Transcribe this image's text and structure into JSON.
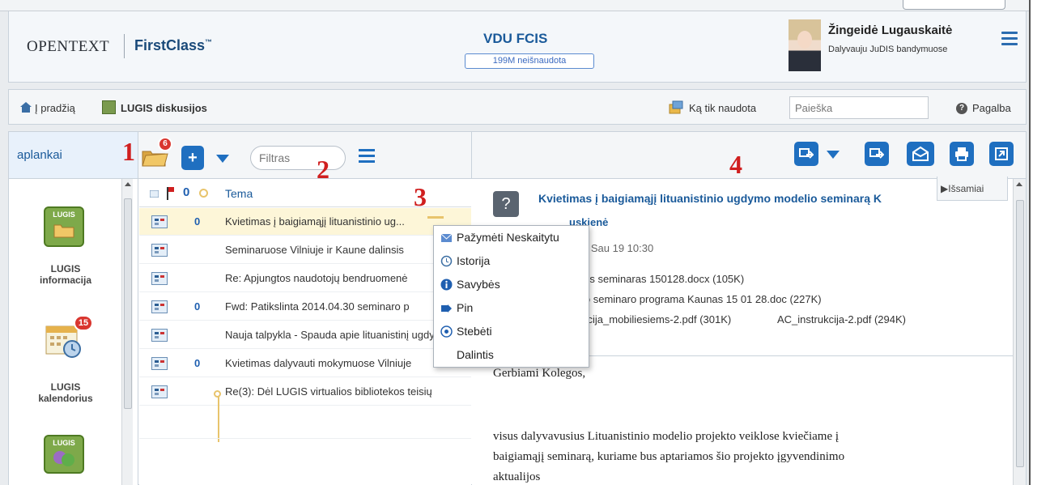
{
  "header": {
    "logo_brand": "OPENTEXT",
    "logo_product": "FirstClass",
    "logo_tm": "™",
    "server_name": "VDU FCIS",
    "server_usage": "199M neišnaudota",
    "user_name": "Žingeidė Lugauskaitė",
    "user_status": "Dalyvauju JuDIS bandymuose"
  },
  "navbar": {
    "home_label": "Į pradžią",
    "folder_label": "LUGIS diskusijos",
    "recent_label": "Ką tik naudota",
    "search_placeholder": "Paieška",
    "help_label": "Pagalba"
  },
  "toolbar": {
    "tab_label": "aplankai",
    "folder_badge": "6",
    "add_label": "+",
    "filter_placeholder": "Filtras"
  },
  "annotations": [
    "1",
    "2",
    "3",
    "4"
  ],
  "folders": [
    {
      "label_line1": "LUGIS",
      "label_line2": "informacija",
      "icon_text": "LUGIS"
    },
    {
      "label_line1": "LUGIS",
      "label_line2": "kalendorius",
      "badge": "15"
    },
    {
      "label_line1": "",
      "label_line2": "",
      "icon_text": "LUGIS"
    }
  ],
  "list": {
    "column_tema": "Tema",
    "rows": [
      {
        "subject": "Kvietimas į baigiamąjį lituanistinio ug...",
        "attachment": true,
        "selected": true
      },
      {
        "subject": "Seminaruose Vilniuje ir Kaune dalinsis",
        "attachment": false
      },
      {
        "subject": "Re: Apjungtos naudotojų bendruomenė",
        "attachment": false
      },
      {
        "subject": "Fwd: Patikslinta 2014.04.30 seminaro p",
        "attachment": true
      },
      {
        "subject": "Nauja talpykla - Spauda apie lituanistinį ugdym",
        "attachment": false
      },
      {
        "subject": "Kvietimas dalyvauti mokymuose Vilniuje",
        "attachment": true
      },
      {
        "subject": "Re(3): Dėl LUGIS virtualios bibliotekos teisių",
        "attachment": false
      }
    ]
  },
  "context_menu": {
    "items": [
      "Pažymėti Neskaitytu",
      "Istorija",
      "Savybės",
      "Pin",
      "Stebėti",
      "Dalintis"
    ]
  },
  "reader": {
    "title": "Kvietimas į baigiamąjį lituanistinio ugdymo modelio seminarą K",
    "expand_label": "▶Išsamiai",
    "sender": "uskienė",
    "date": "5 Sau 19 10:30",
    "attachments": [
      "sis seminaras 150128.docx (105K)",
      "jo seminaro programa Kaunas 15 01 28.doc (227K)",
      "kcija_mobiliesiems-2.pdf (301K)",
      "AC_instrukcija-2.pdf (294K)"
    ],
    "greeting": "Gerbiami Kolegos,",
    "body_line1": "visus dalyvavusius Lituanistinio modelio projekto veiklose kviečiame į",
    "body_line2": "baigiamąjį seminarą, kuriame bus aptariamos šio projekto įgyvendinimo",
    "body_line3": "aktualijos"
  },
  "colors": {
    "accent": "#1f6fc0",
    "badge": "#d9362f",
    "annotation": "#d01f1f",
    "selected_row": "#fdf6d8"
  }
}
